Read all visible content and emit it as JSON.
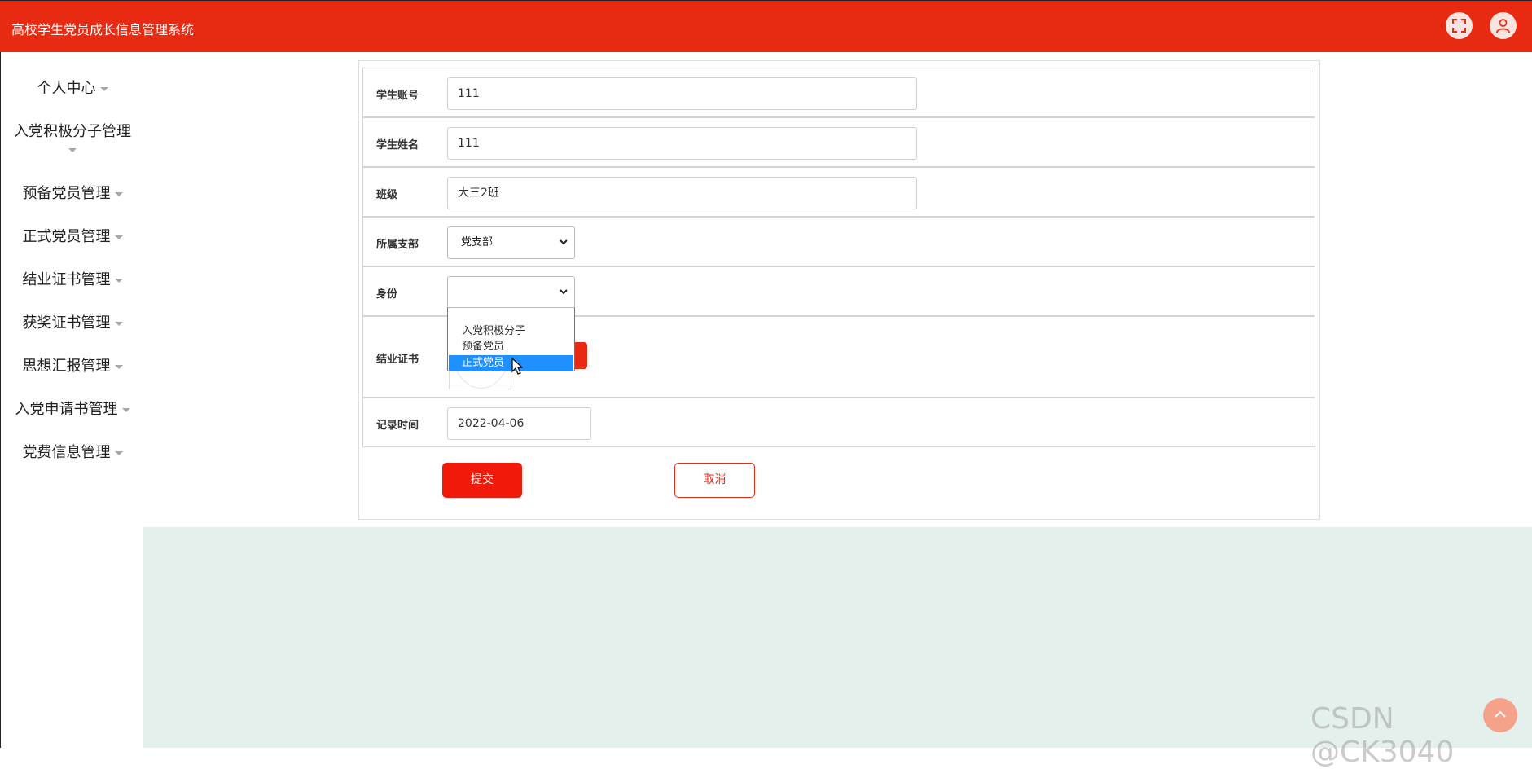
{
  "header": {
    "title": "高校学生党员成长信息管理系统",
    "icons": [
      "fullscreen-icon",
      "user-icon"
    ],
    "bg_color": "#e92a12"
  },
  "sidebar": {
    "items": [
      {
        "label": "个人中心"
      },
      {
        "label": "入党积极分子管理"
      },
      {
        "label": "预备党员管理"
      },
      {
        "label": "正式党员管理"
      },
      {
        "label": "结业证书管理"
      },
      {
        "label": "获奖证书管理"
      },
      {
        "label": "思想汇报管理"
      },
      {
        "label": "入党申请书管理"
      },
      {
        "label": "党费信息管理"
      }
    ]
  },
  "form": {
    "student_account": {
      "label": "学生账号",
      "value": "111"
    },
    "student_name": {
      "label": "学生姓名",
      "value": "111"
    },
    "class": {
      "label": "班级",
      "value": "大三2班"
    },
    "branch": {
      "label": "所属支部",
      "value": "党支部"
    },
    "identity": {
      "label": "身份",
      "value": "",
      "options": [
        "",
        "入党积极分子",
        "预备党员",
        "正式党员"
      ],
      "highlighted": "正式党员"
    },
    "certificate": {
      "label": "结业证书"
    },
    "record_time": {
      "label": "记录时间",
      "value": "2022-04-06"
    },
    "submit_label": "提交",
    "cancel_label": "取消"
  },
  "watermark": "CSDN @CK3040",
  "colors": {
    "accent": "#e92a12",
    "selected_option": "#1e90ff",
    "content_bg": "#e4f0ec"
  }
}
